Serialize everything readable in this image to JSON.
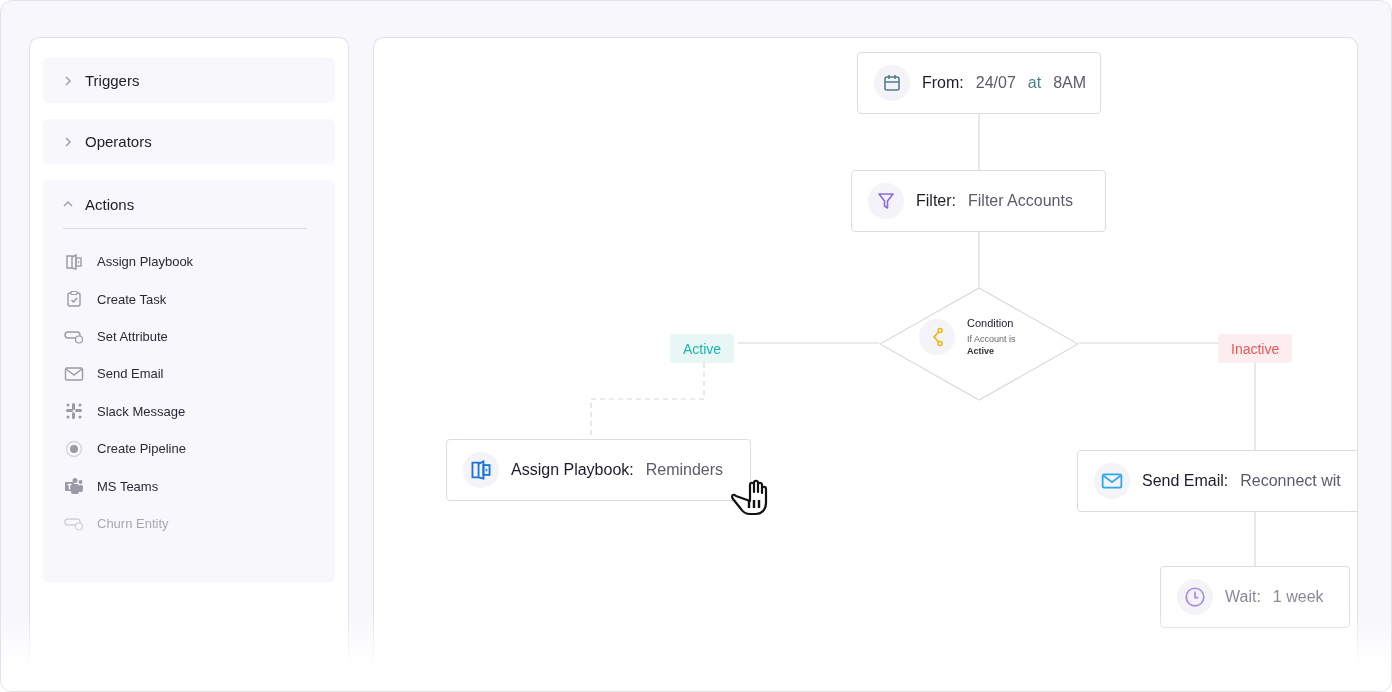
{
  "sidebar": {
    "sections": [
      {
        "label": "Triggers",
        "expanded": false
      },
      {
        "label": "Operators",
        "expanded": false
      },
      {
        "label": "Actions",
        "expanded": true,
        "items": [
          {
            "label": "Assign Playbook",
            "kind": "playbook",
            "disabled": false
          },
          {
            "label": "Create Task",
            "kind": "task",
            "disabled": false
          },
          {
            "label": "Set Attribute",
            "kind": "attribute",
            "disabled": false
          },
          {
            "label": "Send Email",
            "kind": "email",
            "disabled": false
          },
          {
            "label": "Slack Message",
            "kind": "slack",
            "disabled": false
          },
          {
            "label": "Create Pipeline",
            "kind": "pipeline",
            "disabled": false
          },
          {
            "label": "MS Teams",
            "kind": "teams",
            "disabled": false
          },
          {
            "label": "Churn Entity",
            "kind": "attribute",
            "disabled": true
          }
        ]
      }
    ]
  },
  "flow": {
    "nodes": [
      {
        "kind": "schedule",
        "title": "From:",
        "date": "24/07",
        "joiner": "at",
        "time": "8AM"
      },
      {
        "kind": "filter",
        "title": "Filter:",
        "value": "Filter Accounts"
      },
      {
        "kind": "condition",
        "title": "Condition",
        "text": "If Account is **Active**"
      },
      {
        "kind": "playbook",
        "title": "Assign Playbook:",
        "value": "Reminders"
      },
      {
        "kind": "email",
        "title": "Send Email:",
        "value": "Reconnect wit"
      },
      {
        "kind": "wait",
        "title": "Wait:",
        "value": "1 week"
      }
    ],
    "branches": [
      {
        "label": "Active",
        "color": "#20b2aa"
      },
      {
        "label": "Inactive",
        "color": "#e05a5a"
      }
    ]
  }
}
